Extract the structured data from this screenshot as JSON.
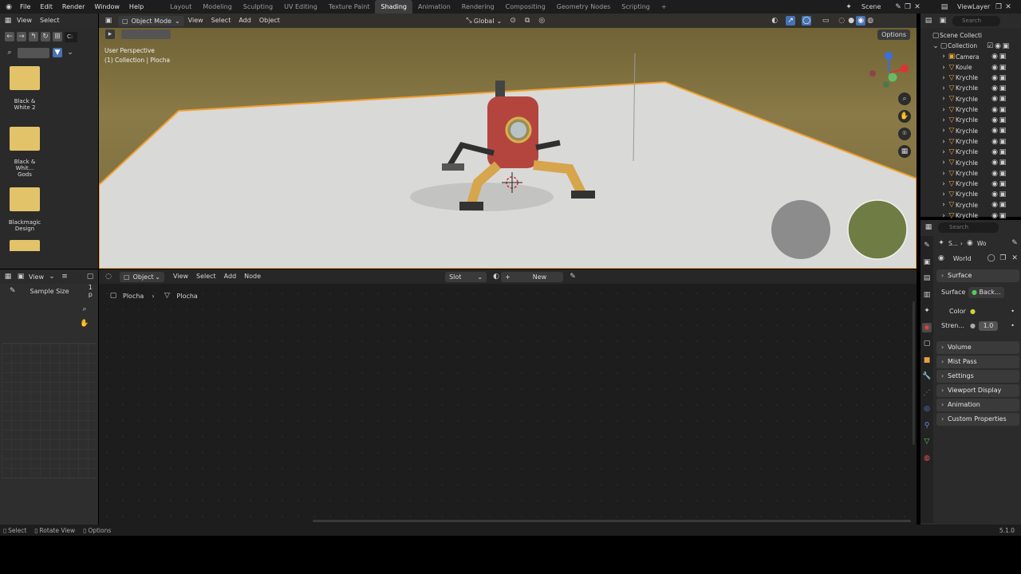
{
  "topbar": {
    "menus": [
      "File",
      "Edit",
      "Render",
      "Window",
      "Help"
    ],
    "workspaces": [
      "Layout",
      "Modeling",
      "Sculpting",
      "UV Editing",
      "Texture Paint",
      "Shading",
      "Animation",
      "Rendering",
      "Compositing",
      "Geometry Nodes",
      "Scripting"
    ],
    "active_workspace": "Shading",
    "add_tab": "+",
    "scene": "Scene",
    "view_layer": "ViewLayer"
  },
  "filebrowser": {
    "menus": [
      "View",
      "Select"
    ],
    "path": "C:",
    "items": [
      {
        "label": "Black & White 2"
      },
      {
        "label": "Black & Whit... Gods"
      },
      {
        "label": "Blackmagic Design"
      }
    ]
  },
  "viewport": {
    "mode": "Object Mode",
    "menus": [
      "View",
      "Select",
      "Add",
      "Object"
    ],
    "transform_orientation": "Global",
    "options_label": "Options",
    "info_line1": "User Perspective",
    "info_line2": "(1) Collection | Plocha"
  },
  "image_editor": {
    "view_label": "View",
    "sample_size_label": "Sample Size",
    "sample_size_value": "1 p"
  },
  "node_editor": {
    "type": "Object",
    "menus": [
      "View",
      "Select",
      "Add",
      "Node"
    ],
    "slot": "Slot",
    "new_label": "New",
    "breadcrumb_object": "Plocha",
    "breadcrumb_mesh": "Plocha"
  },
  "outliner": {
    "scene_collection": "Scene Collecti",
    "collection": "Collection",
    "search_placeholder": "Search",
    "items": [
      {
        "label": "Camera",
        "type": "camera"
      },
      {
        "label": "Koule",
        "type": "mesh"
      },
      {
        "label": "Krychle",
        "type": "mesh"
      },
      {
        "label": "Krychle",
        "type": "mesh"
      },
      {
        "label": "Krychle",
        "type": "mesh"
      },
      {
        "label": "Krychle",
        "type": "mesh"
      },
      {
        "label": "Krychle",
        "type": "mesh"
      },
      {
        "label": "Krychle",
        "type": "mesh"
      },
      {
        "label": "Krychle",
        "type": "mesh"
      },
      {
        "label": "Krychle",
        "type": "mesh"
      },
      {
        "label": "Krychle",
        "type": "mesh"
      },
      {
        "label": "Krychle",
        "type": "mesh"
      },
      {
        "label": "Krychle",
        "type": "mesh"
      },
      {
        "label": "Krychle",
        "type": "mesh"
      },
      {
        "label": "Krychle",
        "type": "mesh"
      },
      {
        "label": "Krychle",
        "type": "mesh"
      }
    ]
  },
  "properties": {
    "search_placeholder": "Search",
    "breadcrumb_scene": "S...",
    "breadcrumb_world": "Wo",
    "world_name": "World",
    "surface_section": "Surface",
    "surface_label": "Surface",
    "surface_value": "Back...",
    "color_label": "Color",
    "strength_label": "Stren...",
    "strength_value": "1.0",
    "sections": [
      "Volume",
      "Mist Pass",
      "Settings",
      "Viewport Display",
      "Animation",
      "Custom Properties"
    ]
  },
  "statusbar": {
    "select": "Select",
    "rotate_view": "Rotate View",
    "options": "Options",
    "version": "5.1.0"
  },
  "colors": {
    "accent_blue": "#4772b3",
    "selection_orange": "#f0a030",
    "mesh_orange": "#e8a040"
  }
}
